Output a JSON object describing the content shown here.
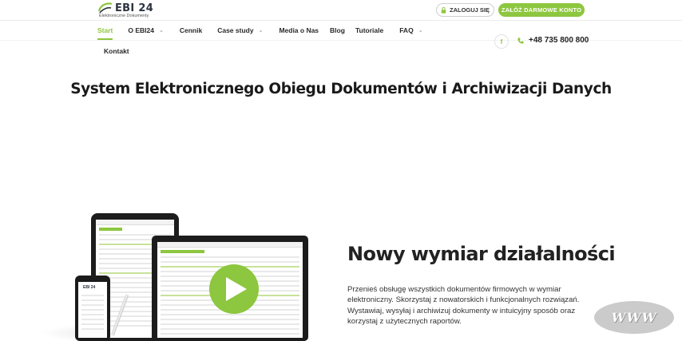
{
  "header": {
    "logo_text": "EBI 24",
    "logo_subtitle": "Elektroniczne Dokumenty",
    "login_label": "ZALOGUJ SIĘ",
    "register_label": "ZAŁÓŻ DARMOWE KONTO",
    "facebook_glyph": "f",
    "phone_number": "+48 735 800 800",
    "accent_color": "#8dc63f"
  },
  "nav": {
    "items": [
      {
        "label": "Start",
        "active": true
      },
      {
        "label": "O EBI24",
        "has_dropdown": true
      },
      {
        "label": "Cennik"
      },
      {
        "label": "Case study",
        "has_dropdown": true
      },
      {
        "label": "Media o Nas"
      },
      {
        "label": "Blog"
      },
      {
        "label": "Tutoriale"
      },
      {
        "label": "FAQ",
        "has_dropdown": true
      }
    ],
    "second_row": "Kontakt",
    "chevron_glyph": "⌄"
  },
  "hero": {
    "title": "System Elektronicznego Obiegu Dokumentów i Archiwizacji Danych"
  },
  "devices": {
    "phone_logo": "EBI 24"
  },
  "section": {
    "title": "Nowy wymiar działalności",
    "text": "Przenieś obsługę wszystkich dokumentów firmowych w wymiar elektroniczny. Skorzystaj z nowatorskich i funkcjonalnych rozwiązań. Wystawiaj, wysyłaj i archiwizuj dokumenty w intuicyjny sposób oraz korzystaj z użytecznych raportów."
  },
  "badge": {
    "text": "WWW"
  }
}
